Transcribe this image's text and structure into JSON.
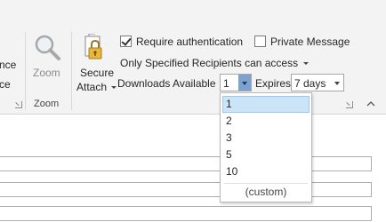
{
  "ribbon": {
    "cut_labels": [
      "nce",
      "ce"
    ],
    "zoom_group": {
      "button_label": "Zoom",
      "group_label": "Zoom",
      "icon": "magnifier-icon"
    },
    "secure_attach": {
      "label_line1": "Secure",
      "label_line2": "Attach",
      "icon": "padlock-attachment-icon"
    },
    "require_auth": {
      "label": "Require authentication",
      "checked": true
    },
    "private_message": {
      "label": "Private Message",
      "checked": false
    },
    "recipients_dropdown": {
      "label": "Only Specified Recipients can access"
    },
    "downloads": {
      "label": "Downloads Available",
      "value": "1"
    },
    "expires": {
      "label": "Expires",
      "value": "7 days"
    }
  },
  "downloads_menu": {
    "options": [
      "1",
      "2",
      "3",
      "5",
      "10"
    ],
    "selected": "1",
    "custom_label": "(custom)"
  },
  "colors": {
    "ribbon_bg": "#f3f3f3",
    "selection_bg": "#cce4f7",
    "active_combo_button": "#7da2ce"
  }
}
